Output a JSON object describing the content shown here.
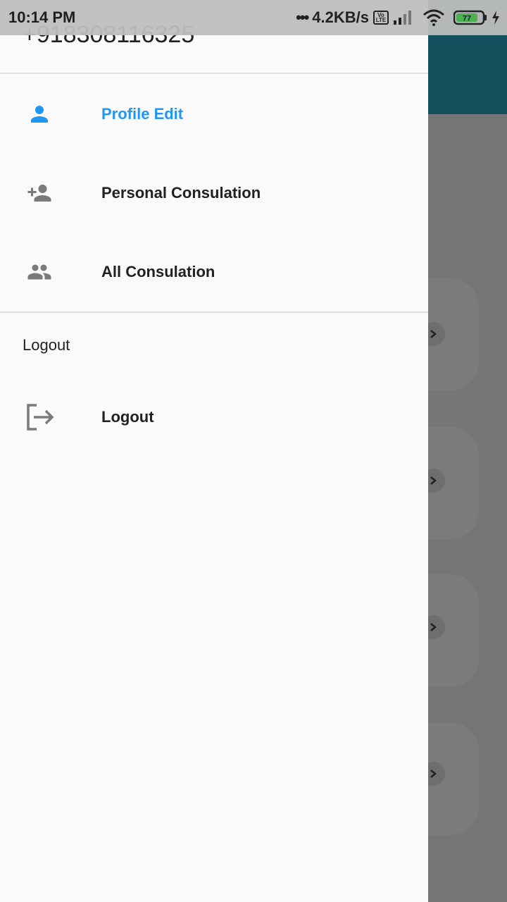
{
  "status_bar": {
    "time": "10:14 PM",
    "network_dots": "•••",
    "network_speed": "4.2KB/s",
    "volte_top": "Vo",
    "volte_bottom": "LTE",
    "battery_level": "77",
    "battery_color": "#4caf50"
  },
  "drawer": {
    "phone_number": "+918308116325",
    "items": [
      {
        "label": "Profile Edit",
        "icon": "person-icon",
        "active": true
      },
      {
        "label": "Personal Consulation",
        "icon": "person-add-icon",
        "active": false
      },
      {
        "label": "All Consulation",
        "icon": "people-icon",
        "active": false
      }
    ],
    "section_header": "Logout",
    "logout_item": {
      "label": "Logout",
      "icon": "logout-icon"
    }
  },
  "colors": {
    "accent": "#2196f3",
    "icon_gray": "#7a7a7a",
    "appbar": "#14505d"
  }
}
